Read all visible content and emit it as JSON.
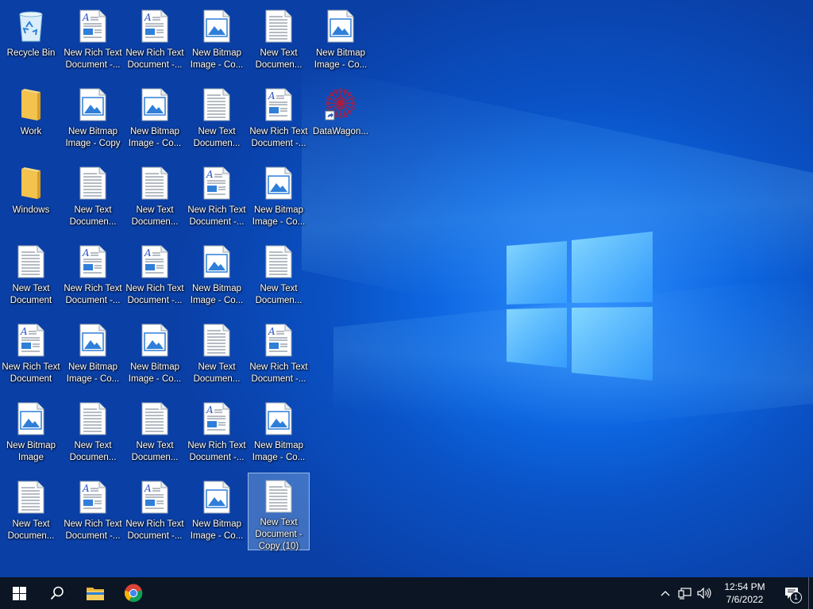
{
  "desktop": {
    "icons": [
      {
        "label": "Recycle Bin",
        "type": "recycle"
      },
      {
        "label": "New Rich Text\nDocument -...",
        "type": "rtf"
      },
      {
        "label": "New Rich Text\nDocument -...",
        "type": "rtf"
      },
      {
        "label": "New Bitmap\nImage - Co...",
        "type": "bmp"
      },
      {
        "label": "New Text\nDocumen...",
        "type": "txt"
      },
      {
        "label": "New Bitmap\nImage - Co...",
        "type": "bmp"
      },
      {
        "label": "Work",
        "type": "folder"
      },
      {
        "label": "New Bitmap\nImage - Copy",
        "type": "bmp"
      },
      {
        "label": "New Bitmap\nImage - Co...",
        "type": "bmp"
      },
      {
        "label": "New Text\nDocumen...",
        "type": "txt"
      },
      {
        "label": "New Rich Text\nDocument -...",
        "type": "rtf"
      },
      {
        "label": "DataWagon...",
        "type": "shortcut"
      },
      {
        "label": "Windows",
        "type": "folder"
      },
      {
        "label": "New Text\nDocumen...",
        "type": "txt"
      },
      {
        "label": "New Text\nDocumen...",
        "type": "txt"
      },
      {
        "label": "New Rich Text\nDocument -...",
        "type": "rtf"
      },
      {
        "label": "New Bitmap\nImage - Co...",
        "type": "bmp"
      },
      {
        "label": "New Text\nDocument",
        "type": "txt"
      },
      {
        "label": "New Rich Text\nDocument -...",
        "type": "rtf"
      },
      {
        "label": "New Rich Text\nDocument -...",
        "type": "rtf"
      },
      {
        "label": "New Bitmap\nImage - Co...",
        "type": "bmp"
      },
      {
        "label": "New Text\nDocumen...",
        "type": "txt"
      },
      {
        "label": "New Rich Text\nDocument",
        "type": "rtf"
      },
      {
        "label": "New Bitmap\nImage - Co...",
        "type": "bmp"
      },
      {
        "label": "New Bitmap\nImage - Co...",
        "type": "bmp"
      },
      {
        "label": "New Text\nDocumen...",
        "type": "txt"
      },
      {
        "label": "New Rich Text\nDocument -...",
        "type": "rtf"
      },
      {
        "label": "New Bitmap\nImage",
        "type": "bmp"
      },
      {
        "label": "New Text\nDocumen...",
        "type": "txt"
      },
      {
        "label": "New Text\nDocumen...",
        "type": "txt"
      },
      {
        "label": "New Rich Text\nDocument -...",
        "type": "rtf"
      },
      {
        "label": "New Bitmap\nImage - Co...",
        "type": "bmp"
      },
      {
        "label": "New Text\nDocumen...",
        "type": "txt"
      },
      {
        "label": "New Rich Text\nDocument -...",
        "type": "rtf"
      },
      {
        "label": "New Rich Text\nDocument -...",
        "type": "rtf"
      },
      {
        "label": "New Bitmap\nImage - Co...",
        "type": "bmp"
      },
      {
        "label": "New Text\nDocument -\nCopy (10)",
        "type": "txt",
        "selected": true
      }
    ]
  },
  "taskbar": {
    "start_icon": "windows-start-icon",
    "search_icon": "search-icon",
    "pinned": [
      {
        "name": "file-explorer",
        "icon": "folder-icon"
      },
      {
        "name": "chrome",
        "icon": "chrome-icon"
      }
    ],
    "tray": {
      "time": "12:54 PM",
      "date": "7/6/2022",
      "notification_count": "1"
    }
  }
}
